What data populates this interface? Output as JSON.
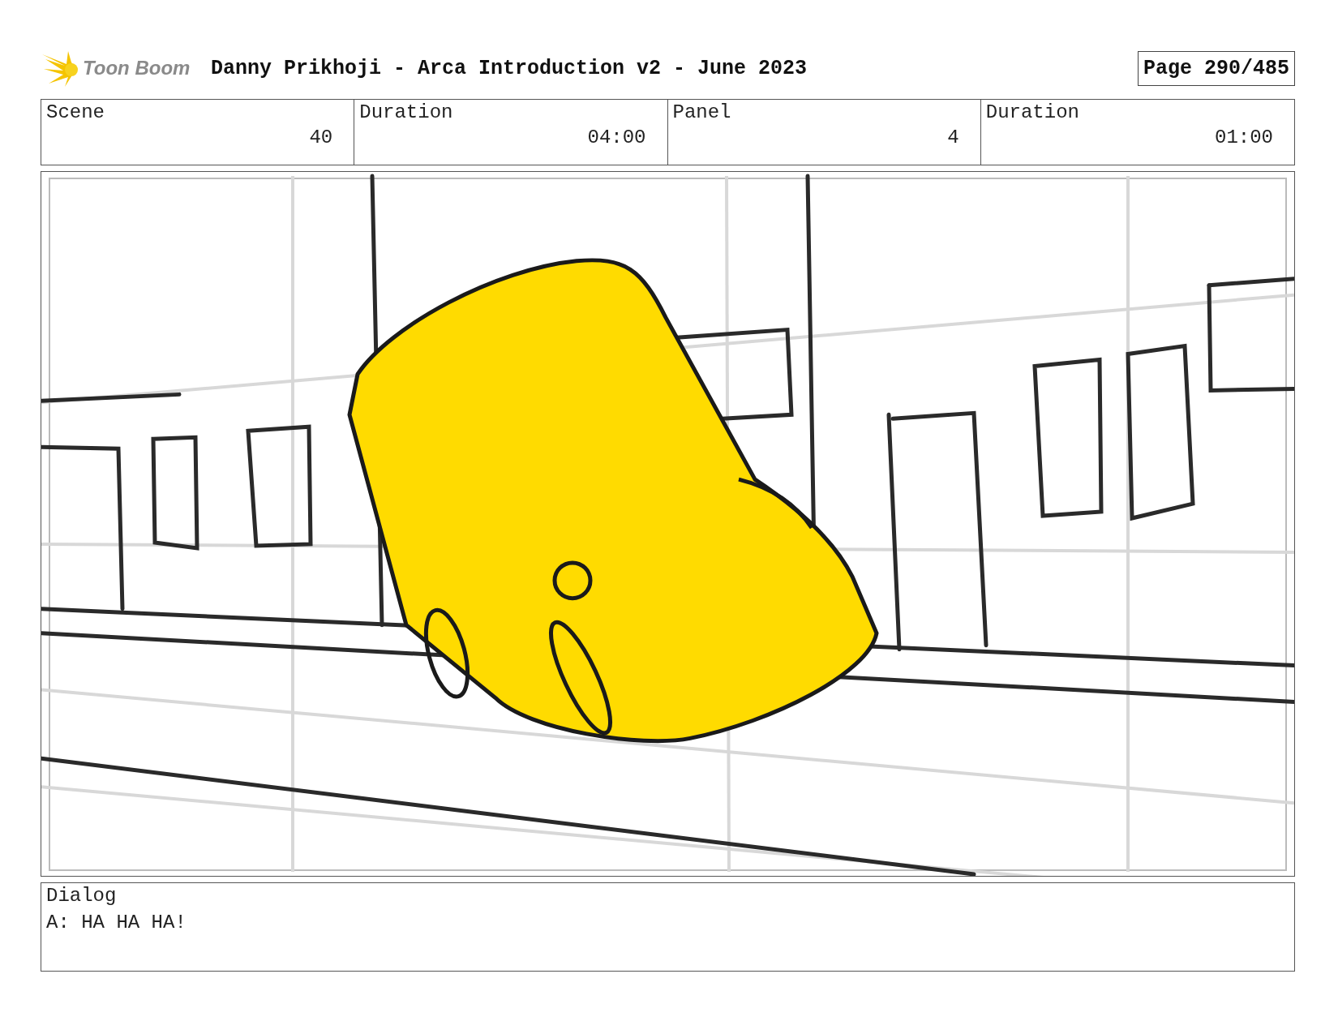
{
  "header": {
    "logo_text": "Toon Boom",
    "title": "Danny Prikhoji - Arca Introduction v2 - June 2023",
    "page": "Page 290/485"
  },
  "fields": [
    {
      "label": "Scene",
      "value": "40"
    },
    {
      "label": "Duration",
      "value": "04:00"
    },
    {
      "label": "Panel",
      "value": "4"
    },
    {
      "label": "Duration",
      "value": "01:00"
    }
  ],
  "dialog": {
    "label": "Dialog",
    "text": "A: HA HA HA!"
  }
}
